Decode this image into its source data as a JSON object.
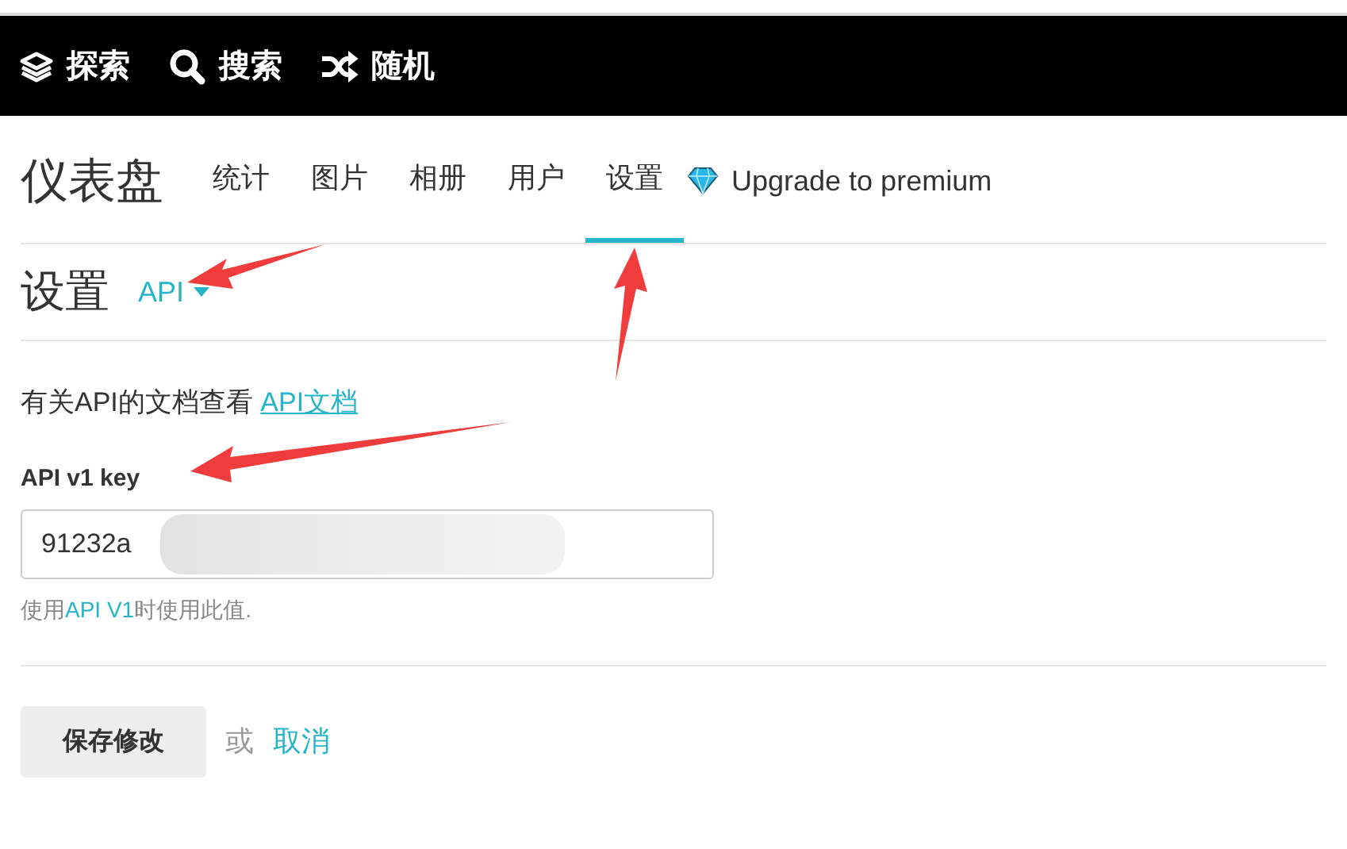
{
  "top_nav": [
    {
      "kind": "layers",
      "label": "探索"
    },
    {
      "kind": "search",
      "label": "搜索"
    },
    {
      "kind": "shuffle",
      "label": "随机"
    }
  ],
  "dashboard": {
    "title": "仪表盘",
    "tabs": [
      {
        "label": "统计",
        "selected": false
      },
      {
        "label": "图片",
        "selected": false
      },
      {
        "label": "相册",
        "selected": false
      },
      {
        "label": "用户",
        "selected": false
      },
      {
        "label": "设置",
        "selected": true
      }
    ],
    "upgrade": "Upgrade to premium"
  },
  "section": {
    "title": "设置",
    "dropdown": "API"
  },
  "docs_note": {
    "text": "有关API的文档查看",
    "link": "API文档"
  },
  "api_key": {
    "label": "API v1 key",
    "value": "91232a",
    "help_before": "使用",
    "help_link": "API V1",
    "help_after": "时使用此值."
  },
  "actions": {
    "save": "保存修改",
    "or": "或",
    "cancel": "取消"
  }
}
